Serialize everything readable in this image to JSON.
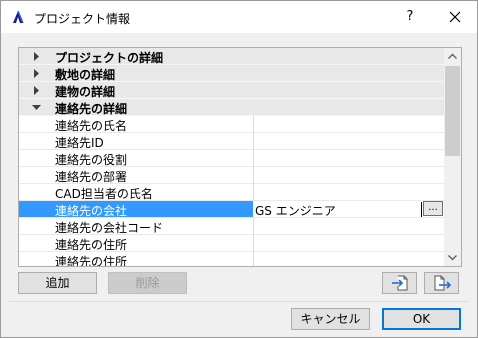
{
  "window": {
    "title": "プロジェクト情報",
    "help_label": "?"
  },
  "colors": {
    "selection": "#3399ff",
    "group_bg": "#e8e8e8",
    "accent": "#0078d7"
  },
  "list": {
    "groups": [
      {
        "label": "プロジェクトの詳細",
        "expanded": false
      },
      {
        "label": "敷地の詳細",
        "expanded": false
      },
      {
        "label": "建物の詳細",
        "expanded": false
      },
      {
        "label": "連絡先の詳細",
        "expanded": true
      }
    ],
    "fields": [
      {
        "label": "連絡先の氏名",
        "value": ""
      },
      {
        "label": "連絡先ID",
        "value": ""
      },
      {
        "label": "連絡先の役割",
        "value": ""
      },
      {
        "label": "連絡先の部署",
        "value": ""
      },
      {
        "label": "CAD担当者の氏名",
        "value": ""
      },
      {
        "label": "連絡先の会社",
        "value": "GS エンジニア",
        "selected": true,
        "button": "..."
      },
      {
        "label": "連絡先の会社コード",
        "value": ""
      },
      {
        "label": "連絡先の住所",
        "value": ""
      },
      {
        "label": "連絡先の住所",
        "value": ""
      }
    ]
  },
  "buttons": {
    "add": "追加",
    "delete": "削除",
    "cancel": "キャンセル",
    "ok": "OK",
    "import_icon": "import-icon",
    "export_icon": "export-icon"
  }
}
